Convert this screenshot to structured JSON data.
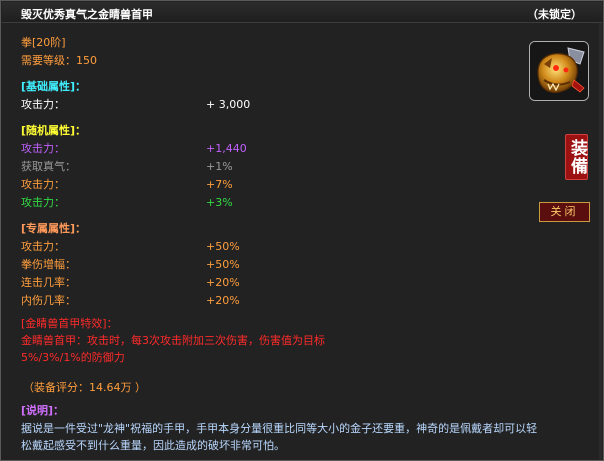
{
  "header": {
    "title": "毁灭优秀真气之金睛兽首甲",
    "lock_status": "（未锁定）"
  },
  "item": {
    "type": "拳[20阶]",
    "level_req": "需要等级：150"
  },
  "base": {
    "heading": "[基础属性]：",
    "rows": [
      {
        "label": "攻击力：",
        "value": "+ 3,000"
      }
    ]
  },
  "random": {
    "heading": "[随机属性]：",
    "rows": [
      {
        "label": "攻击力：",
        "value": "+1,440"
      },
      {
        "label": "获取真气：",
        "value": "+1%"
      },
      {
        "label": "攻击力：",
        "value": "+7%"
      },
      {
        "label": "攻击力：",
        "value": "+3%"
      }
    ]
  },
  "exclusive": {
    "heading": "[专属属性]：",
    "rows": [
      {
        "label": "攻击力：",
        "value": "+50%"
      },
      {
        "label": "拳伤增幅：",
        "value": "+50%"
      },
      {
        "label": "连击几率：",
        "value": "+20%"
      },
      {
        "label": "内伤几率：",
        "value": "+20%"
      }
    ]
  },
  "special": {
    "heading": "[金睛兽首甲特效]：",
    "line1": "金睛兽首甲：攻击时，每3次攻击附加三次伤害，伤害值为目标",
    "line2": "5%/3%/1%的防御力"
  },
  "score": "（装备评分：14.64万 ）",
  "desc": {
    "heading": "[说明]：",
    "line1": "据说是一件受过\"龙神\"祝福的手甲，手甲本身分量很重比同等大小的金子还要重，神奇的是佩戴者却可以轻",
    "line2": "松戴起感受不到什么重量，因此造成的破坏非常可怕。"
  },
  "buttons": {
    "equip": "装備",
    "close": "关闭"
  },
  "icon": {
    "name": "golden-beast-gauntlet-icon"
  }
}
